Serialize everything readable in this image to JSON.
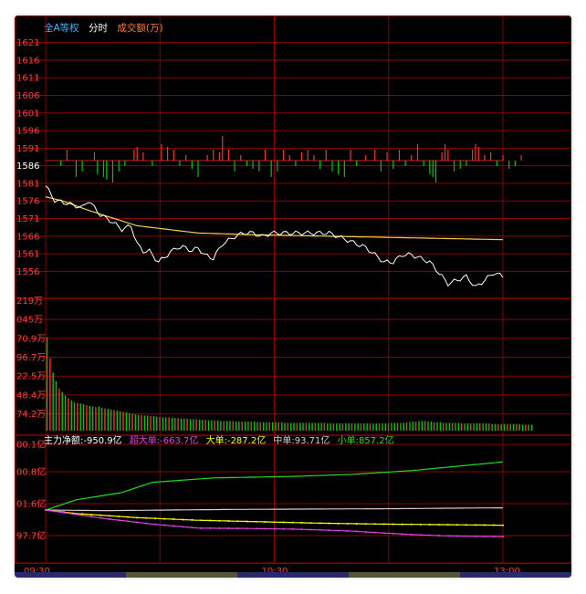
{
  "header": {
    "index_name": "全A等权",
    "mode": "分时",
    "indicator": "成交额(万)"
  },
  "colors": {
    "background": "#000000",
    "grid": "#8b0000",
    "axis_text": "#ff3c3c",
    "price_line": "#ffffff",
    "avg_line": "#e8d44a",
    "up": "#ff3030",
    "down": "#00c800",
    "super_large": "#e040e0",
    "large": "#ffff00",
    "medium": "#d9c9c9",
    "small": "#22dd22",
    "main": "#ffffff"
  },
  "price_axis": {
    "labels": [
      "1621",
      "1616",
      "1611",
      "1606",
      "1601",
      "1596",
      "1591",
      "1586",
      "1581",
      "1576",
      "1571",
      "1566",
      "1561",
      "1556"
    ],
    "base_label": "1586"
  },
  "volume_axis": {
    "labels": [
      "219万",
      "045万",
      "70.9万",
      "96.7万",
      "22.5万",
      "48.4万",
      "74.2万"
    ]
  },
  "flow_axis": {
    "labels": [
      "00.1亿",
      "00.8亿",
      "01.6亿",
      "97.7亿"
    ]
  },
  "time_axis": {
    "labels": [
      "09:30",
      "10:30",
      "13:00"
    ]
  },
  "flow_legend": {
    "main": "主力净额:-950.9亿",
    "super_large": "超大单:-663.7亿",
    "large": "大单:-287.2亿",
    "medium": "中单:93.71亿",
    "small": "小单:857.2亿"
  },
  "chart_data": {
    "type": "line",
    "minutes": 150,
    "price": {
      "base": 1586,
      "ylim": [
        1553,
        1621
      ],
      "keyframes": [
        [
          0,
          1579
        ],
        [
          3,
          1575
        ],
        [
          8,
          1574
        ],
        [
          12,
          1573
        ],
        [
          14,
          1575
        ],
        [
          18,
          1571
        ],
        [
          22,
          1569
        ],
        [
          25,
          1567
        ],
        [
          28,
          1568
        ],
        [
          30,
          1563
        ],
        [
          32,
          1561
        ],
        [
          34,
          1561
        ],
        [
          37,
          1558
        ],
        [
          40,
          1560
        ],
        [
          43,
          1562
        ],
        [
          46,
          1562
        ],
        [
          48,
          1561
        ],
        [
          50,
          1562
        ],
        [
          52,
          1560
        ],
        [
          55,
          1559
        ],
        [
          58,
          1563
        ],
        [
          62,
          1565
        ],
        [
          65,
          1566
        ],
        [
          68,
          1566
        ],
        [
          71,
          1565
        ],
        [
          74,
          1566
        ],
        [
          78,
          1566
        ],
        [
          82,
          1566
        ],
        [
          86,
          1566
        ],
        [
          90,
          1566
        ],
        [
          93,
          1566
        ],
        [
          96,
          1565
        ],
        [
          99,
          1564
        ],
        [
          102,
          1563
        ],
        [
          105,
          1562
        ],
        [
          108,
          1560
        ],
        [
          111,
          1558
        ],
        [
          114,
          1558
        ],
        [
          117,
          1560
        ],
        [
          120,
          1560
        ],
        [
          123,
          1559
        ],
        [
          126,
          1558
        ],
        [
          129,
          1555
        ],
        [
          132,
          1552
        ],
        [
          135,
          1553
        ],
        [
          138,
          1554
        ],
        [
          141,
          1551
        ],
        [
          144,
          1553
        ],
        [
          147,
          1555
        ],
        [
          150,
          1554
        ],
        [
          153,
          1555
        ],
        [
          156,
          1556
        ],
        [
          158,
          1555
        ],
        [
          160,
          1555
        ]
      ],
      "avg": [
        [
          0,
          1576
        ],
        [
          5,
          1575
        ],
        [
          15,
          1572
        ],
        [
          30,
          1568
        ],
        [
          50,
          1566
        ],
        [
          70,
          1565.5
        ],
        [
          100,
          1565
        ],
        [
          130,
          1564.5
        ],
        [
          160,
          1564
        ]
      ],
      "change_bars": [
        [
          5,
          -1
        ],
        [
          7,
          2
        ],
        [
          10,
          -3
        ],
        [
          12,
          -2
        ],
        [
          16,
          1.5
        ],
        [
          17,
          -2.5
        ],
        [
          19,
          -3
        ],
        [
          20,
          -3.5
        ],
        [
          22,
          -4
        ],
        [
          24,
          -2
        ],
        [
          26,
          -1
        ],
        [
          29,
          2
        ],
        [
          30,
          2.5
        ],
        [
          32,
          1.5
        ],
        [
          35,
          -1
        ],
        [
          38,
          3
        ],
        [
          40,
          2.5
        ],
        [
          42,
          2
        ],
        [
          44,
          -1
        ],
        [
          46,
          1
        ],
        [
          48,
          -1.5
        ],
        [
          50,
          -3
        ],
        [
          53,
          1
        ],
        [
          55,
          2
        ],
        [
          57,
          1.5
        ],
        [
          58,
          4.5
        ],
        [
          60,
          2
        ],
        [
          62,
          -2
        ],
        [
          64,
          1
        ],
        [
          66,
          -1
        ],
        [
          68,
          -1.5
        ],
        [
          70,
          -2
        ],
        [
          72,
          2
        ],
        [
          74,
          -3
        ],
        [
          76,
          -2
        ],
        [
          78,
          2
        ],
        [
          80,
          1
        ],
        [
          82,
          -1
        ],
        [
          84,
          1.5
        ],
        [
          86,
          2
        ],
        [
          88,
          1
        ],
        [
          90,
          -1.5
        ],
        [
          92,
          2
        ],
        [
          94,
          -2
        ],
        [
          96,
          -2.5
        ],
        [
          98,
          -3
        ],
        [
          100,
          2
        ],
        [
          102,
          -1
        ],
        [
          105,
          1
        ],
        [
          108,
          2
        ],
        [
          110,
          -2
        ],
        [
          112,
          1.5
        ],
        [
          114,
          -1.5
        ],
        [
          116,
          2
        ],
        [
          118,
          -1
        ],
        [
          120,
          1
        ],
        [
          122,
          3
        ],
        [
          124,
          -1
        ],
        [
          126,
          -2.5
        ],
        [
          127,
          -3
        ],
        [
          128,
          -4
        ],
        [
          130,
          1.5
        ],
        [
          131,
          3
        ],
        [
          132,
          2
        ],
        [
          134,
          -2
        ],
        [
          136,
          -1.5
        ],
        [
          138,
          -1
        ],
        [
          140,
          2
        ],
        [
          141,
          3
        ],
        [
          142,
          2.5
        ],
        [
          144,
          1
        ],
        [
          146,
          1.5
        ],
        [
          148,
          -1
        ],
        [
          150,
          1
        ],
        [
          152,
          -1.5
        ],
        [
          154,
          -1
        ],
        [
          156,
          1
        ]
      ]
    },
    "volume": {
      "ylim": [
        0,
        219
      ],
      "values": [
        155,
        120,
        96,
        82,
        70,
        64,
        58,
        54,
        50,
        47,
        46,
        45,
        44,
        42,
        41,
        40,
        39,
        40,
        38,
        37,
        36,
        35,
        34,
        33,
        32,
        31,
        30,
        29,
        28,
        27,
        26,
        26,
        25,
        25,
        24,
        24,
        23,
        23,
        22,
        22,
        22,
        21,
        21,
        21,
        20,
        20,
        20,
        19,
        19,
        19,
        18,
        18,
        18,
        17,
        17,
        17,
        17,
        16,
        16,
        16,
        16,
        16,
        15,
        15,
        15,
        15,
        15,
        15,
        15,
        14,
        14,
        14,
        14,
        14,
        14,
        14,
        14,
        14,
        13,
        13,
        13,
        13,
        13,
        13,
        13,
        13,
        13,
        13,
        13,
        13,
        13,
        13,
        12,
        12,
        12,
        12,
        12,
        12,
        12,
        12,
        12,
        12,
        12,
        12,
        12,
        12,
        12,
        12,
        12,
        12,
        12,
        12,
        12,
        13,
        13,
        13,
        13,
        13,
        14,
        14,
        15,
        15,
        16,
        16,
        16,
        15,
        15,
        14,
        14,
        14,
        13,
        13,
        13,
        13,
        13,
        13,
        12,
        12,
        12,
        12,
        12,
        12,
        12,
        12,
        12,
        12,
        11,
        11,
        11,
        11,
        11,
        11,
        11,
        11,
        11,
        11,
        10,
        10,
        10,
        10
      ]
    },
    "flows": {
      "small": [
        [
          0,
          0
        ],
        [
          10,
          35
        ],
        [
          25,
          60
        ],
        [
          35,
          95
        ],
        [
          55,
          110
        ],
        [
          80,
          115
        ],
        [
          100,
          122
        ],
        [
          120,
          135
        ],
        [
          140,
          155
        ],
        [
          150,
          165
        ],
        [
          160,
          172
        ]
      ],
      "medium": [
        [
          0,
          0
        ],
        [
          20,
          -2
        ],
        [
          40,
          0
        ],
        [
          60,
          2
        ],
        [
          80,
          3
        ],
        [
          100,
          4
        ],
        [
          120,
          5
        ],
        [
          140,
          7
        ],
        [
          160,
          8
        ]
      ],
      "large": [
        [
          0,
          0
        ],
        [
          10,
          -12
        ],
        [
          30,
          -26
        ],
        [
          50,
          -35
        ],
        [
          70,
          -40
        ],
        [
          90,
          -45
        ],
        [
          110,
          -48
        ],
        [
          130,
          -50
        ],
        [
          150,
          -52
        ],
        [
          160,
          -52
        ]
      ],
      "super_large": [
        [
          0,
          0
        ],
        [
          8,
          -12
        ],
        [
          20,
          -30
        ],
        [
          35,
          -48
        ],
        [
          50,
          -62
        ],
        [
          65,
          -63
        ],
        [
          80,
          -65
        ],
        [
          90,
          -68
        ],
        [
          100,
          -72
        ],
        [
          110,
          -78
        ],
        [
          120,
          -84
        ],
        [
          130,
          -88
        ],
        [
          140,
          -90
        ],
        [
          150,
          -91
        ],
        [
          160,
          -91
        ]
      ]
    }
  }
}
